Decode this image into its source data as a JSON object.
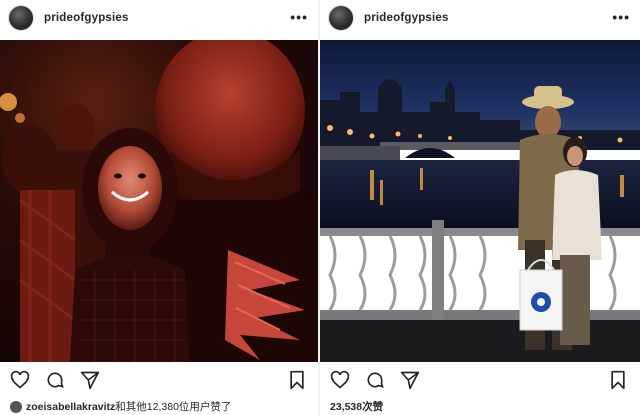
{
  "posts": [
    {
      "username": "prideofgypsies",
      "more_label": "•••",
      "likes_user": "zoeisabellakravitz",
      "likes_suffix": "和其他12,380位用户赞了",
      "icons": [
        "heart-icon",
        "comment-icon",
        "share-icon",
        "bookmark-icon"
      ]
    },
    {
      "username": "prideofgypsies",
      "more_label": "•••",
      "likes_text": "23,538次赞",
      "icons": [
        "heart-icon",
        "comment-icon",
        "share-icon",
        "bookmark-icon"
      ]
    }
  ],
  "colors": {
    "text": "#262626",
    "left_photo_tone": "#b0281c",
    "right_photo_sky": "#14214a"
  }
}
